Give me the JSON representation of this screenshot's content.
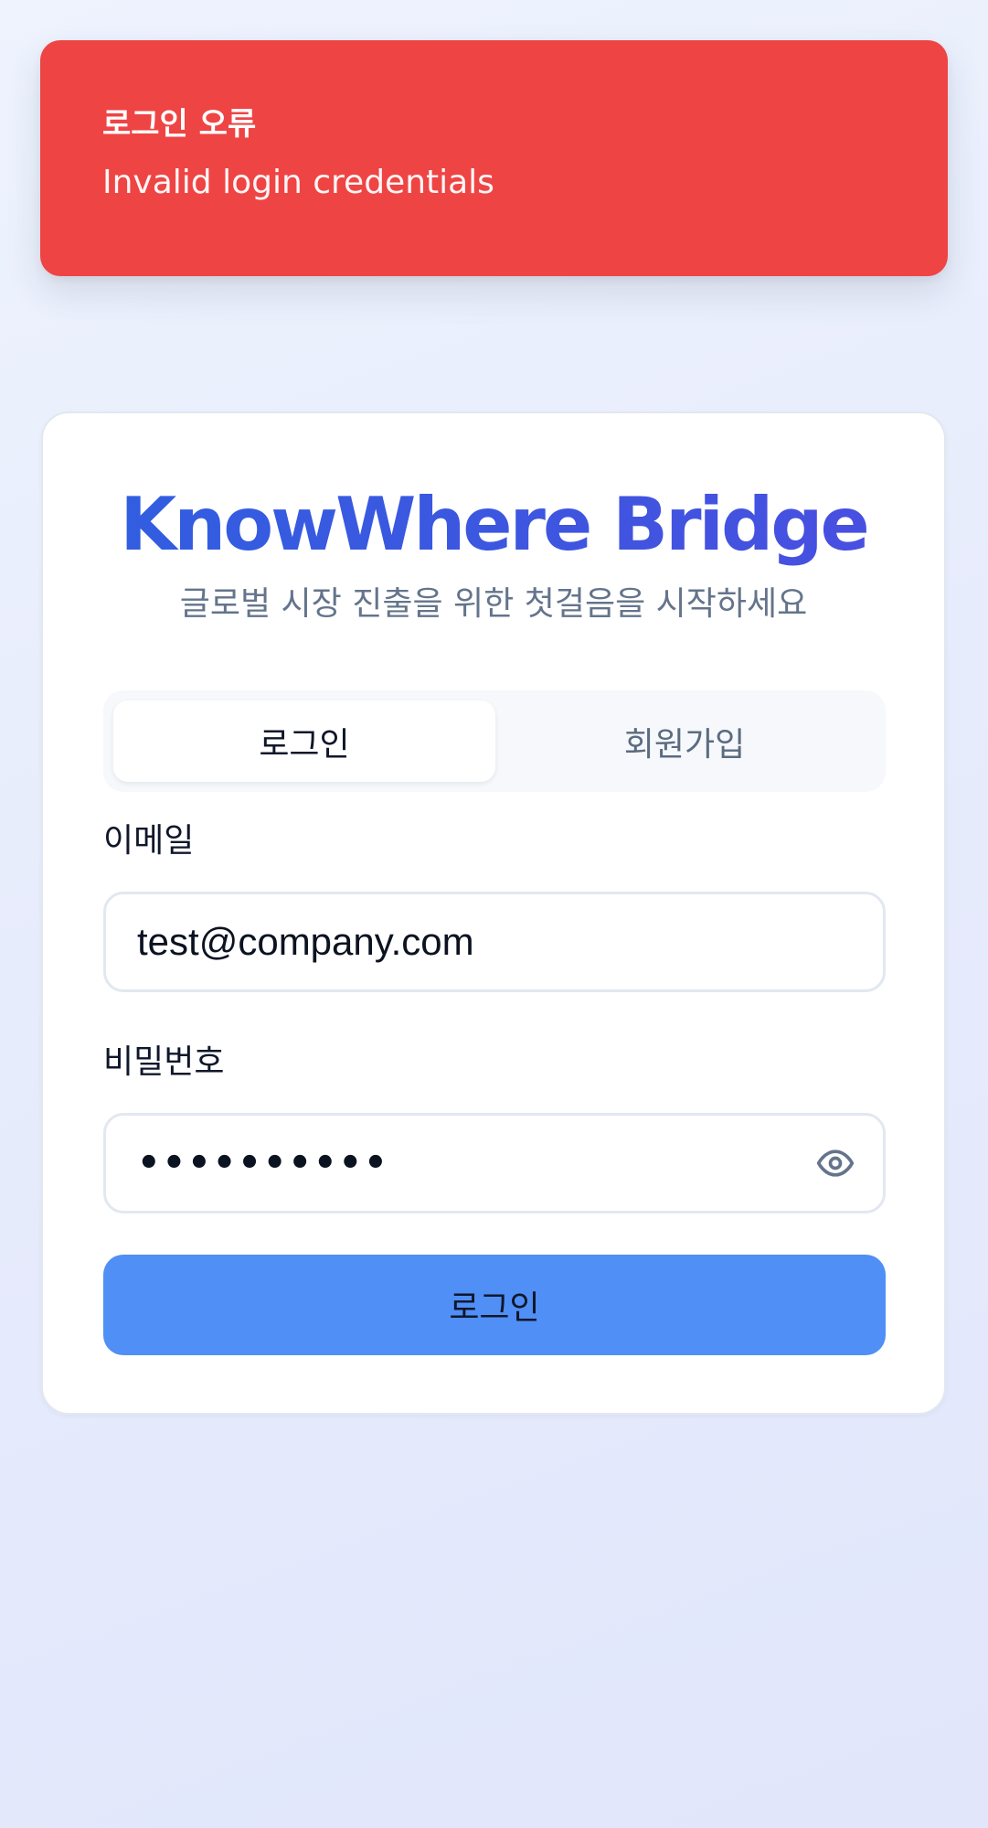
{
  "toast": {
    "title": "로그인 오류",
    "message": "Invalid login credentials",
    "color": "#ef4444"
  },
  "card": {
    "brand": "KnowWhere Bridge",
    "subtitle": "글로벌 시장 진출을 위한 첫걸음을 시작하세요"
  },
  "tabs": [
    {
      "label": "로그인",
      "active": true
    },
    {
      "label": "회원가입",
      "active": false
    }
  ],
  "form": {
    "email": {
      "label": "이메일",
      "value": "test@company.com"
    },
    "password": {
      "label": "비밀번호",
      "masked_value": "••••••••••",
      "toggle_icon": "eye-icon"
    },
    "submit_label": "로그인"
  },
  "colors": {
    "accent": "#508ff5",
    "brand_start": "#2f5fe0",
    "brand_end": "#4a4ee0",
    "error": "#ef4444"
  }
}
